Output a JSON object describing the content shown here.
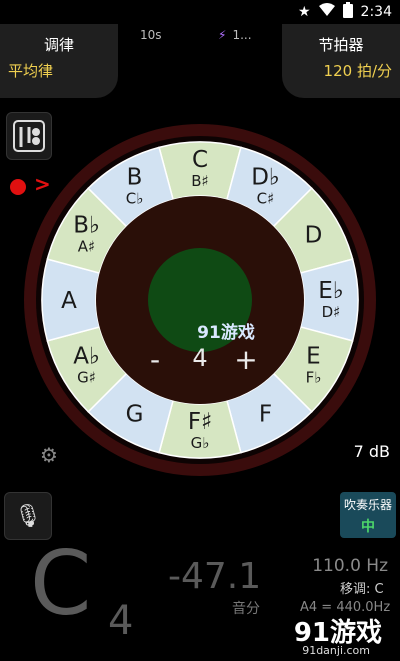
{
  "status": {
    "time": "2:34",
    "star_icon": "star-icon",
    "wifi_icon": "wifi-icon",
    "battery_icon": "battery-icon"
  },
  "header": {
    "temperament_title": "调律",
    "temperament_value": "平均律",
    "timer": "10s",
    "bolt_icon": "bolt-icon",
    "indicator_text": "1...",
    "metronome_title": "节拍器",
    "metronome_value": "120 拍/分"
  },
  "wheel": {
    "notes": [
      {
        "main": "C",
        "sub": "B♯"
      },
      {
        "main": "D♭",
        "sub": "C♯"
      },
      {
        "main": "D",
        "sub": ""
      },
      {
        "main": "E♭",
        "sub": "D♯"
      },
      {
        "main": "E",
        "sub": "F♭"
      },
      {
        "main": "F",
        "sub": ""
      },
      {
        "main": "F♯",
        "sub": "G♭"
      },
      {
        "main": "G",
        "sub": ""
      },
      {
        "main": "A♭",
        "sub": "G♯"
      },
      {
        "main": "A",
        "sub": ""
      },
      {
        "main": "B♭",
        "sub": "A♯"
      },
      {
        "main": "B",
        "sub": "C♭"
      }
    ],
    "minus": "-",
    "offset_value": "4",
    "plus": "+",
    "watermark_center": "91游戏"
  },
  "side": {
    "volume": "7 dB"
  },
  "instrument": {
    "title": "吹奏乐器",
    "value": "中"
  },
  "readout": {
    "note": "C",
    "octave": "4",
    "cents": "-47.1",
    "cents_label": "音分",
    "frequency": "110.0 Hz",
    "transpose": "移调: C",
    "reference": "A4 = 440.0Hz"
  },
  "watermark": {
    "brand": "91游戏",
    "url": "91danji.com"
  },
  "colors": {
    "accent_yellow": "#f0d050",
    "green_text": "#4dd66a",
    "record_red": "#e01010",
    "wheel_green": "#d6e6c2",
    "wheel_blue": "#d2e2f2"
  }
}
